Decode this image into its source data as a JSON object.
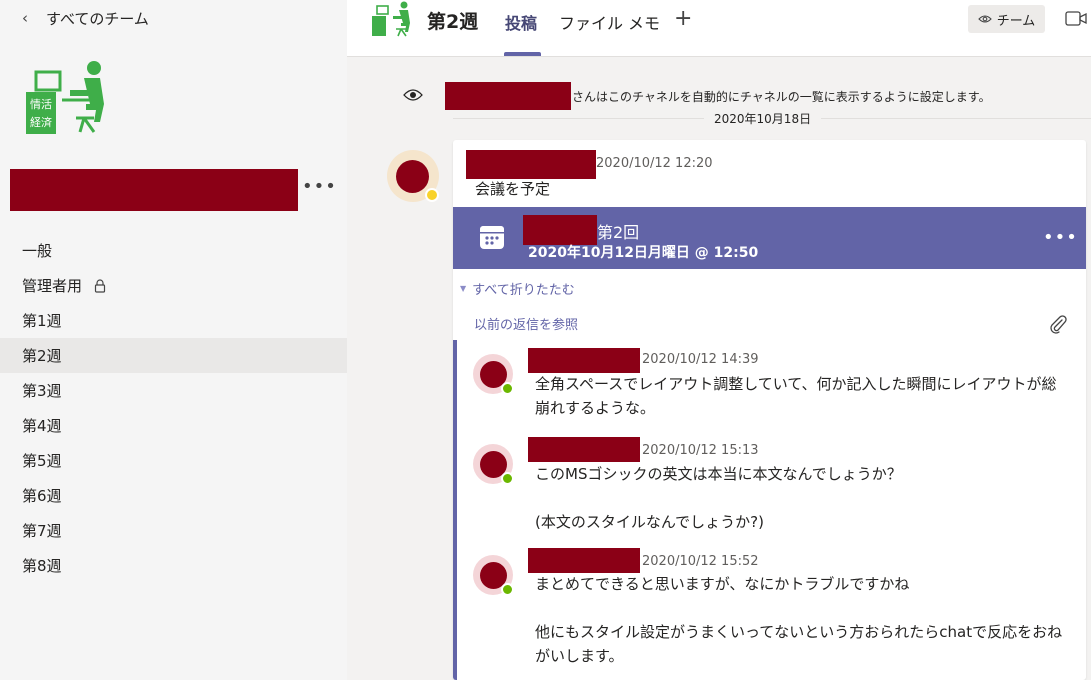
{
  "sidebar": {
    "back_label": "すべてのチーム",
    "logo_text": "情活\n経済",
    "more_label": "•••",
    "channels": [
      {
        "label": "一般"
      },
      {
        "label": "管理者用"
      },
      {
        "label": "第1週"
      },
      {
        "label": "第2週"
      },
      {
        "label": "第3週"
      },
      {
        "label": "第4週"
      },
      {
        "label": "第5週"
      },
      {
        "label": "第6週"
      },
      {
        "label": "第7週"
      },
      {
        "label": "第8週"
      }
    ],
    "active_channel": "第2週"
  },
  "header": {
    "title": "第2週",
    "tabs": [
      "投稿",
      "ファイル",
      "メモ"
    ],
    "add_tab": "+",
    "team_button": "チーム"
  },
  "feed": {
    "system_message": "さんはこのチャネルを自動的にチャネルの一覧に表示するように設定します。",
    "date_separator": "2020年10月18日",
    "post": {
      "time": "2020/10/12 12:20",
      "body": "会議を予定",
      "meeting": {
        "title": "第2回",
        "date": "2020年10月12日月曜日 @ 12:50",
        "more": "•••"
      },
      "collapse_label": "すべて折りたたむ",
      "previous_replies": "以前の返信を参照",
      "replies": [
        {
          "time": "2020/10/12 14:39",
          "text": "全角スペースでレイアウト調整していて、何か記入した瞬間にレイアウトが総崩れするような。"
        },
        {
          "time": "2020/10/12 15:13",
          "text": "このMSゴシックの英文は本当に本文なんでしょうか？\n\n(本文のスタイルなんでしょうか?)"
        },
        {
          "time": "2020/10/12 15:52",
          "text": "まとめてできると思いますが、なにかトラブルですかね\n\n他にもスタイル設定がうまくいってないという方おられたらchatで反応をおねがいします。"
        }
      ]
    }
  },
  "colors": {
    "accent": "#6264a7",
    "redaction": "#8b0016",
    "logo_green": "#3fae49",
    "presence_available": "#6bb700",
    "presence_away": "#f8d22a"
  }
}
